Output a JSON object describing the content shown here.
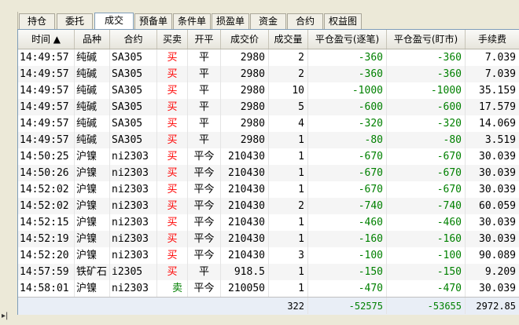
{
  "tabs": [
    {
      "label": "持仓"
    },
    {
      "label": "委托"
    },
    {
      "label": "成交"
    },
    {
      "label": "预备单"
    },
    {
      "label": "条件单"
    },
    {
      "label": "损盈单"
    },
    {
      "label": "资金"
    },
    {
      "label": "合约"
    },
    {
      "label": "权益图"
    }
  ],
  "active_tab": "成交",
  "columns": {
    "time": "时间 ▲",
    "product": "品种",
    "contract": "合约",
    "side": "买卖",
    "openclose": "开平",
    "price": "成交价",
    "qty": "成交量",
    "pnl_trade": "平仓盈亏(逐笔)",
    "pnl_mark": "平仓盈亏(盯市)",
    "fee": "手续费"
  },
  "rows": [
    {
      "time": "14:49:57",
      "product": "纯碱",
      "contract": "SA305",
      "side": "买",
      "openclose": "平",
      "price": "2980",
      "qty": "2",
      "pnl_trade": "-360",
      "pnl_mark": "-360",
      "fee": "7.039"
    },
    {
      "time": "14:49:57",
      "product": "纯碱",
      "contract": "SA305",
      "side": "买",
      "openclose": "平",
      "price": "2980",
      "qty": "2",
      "pnl_trade": "-360",
      "pnl_mark": "-360",
      "fee": "7.039"
    },
    {
      "time": "14:49:57",
      "product": "纯碱",
      "contract": "SA305",
      "side": "买",
      "openclose": "平",
      "price": "2980",
      "qty": "10",
      "pnl_trade": "-1000",
      "pnl_mark": "-1000",
      "fee": "35.159"
    },
    {
      "time": "14:49:57",
      "product": "纯碱",
      "contract": "SA305",
      "side": "买",
      "openclose": "平",
      "price": "2980",
      "qty": "5",
      "pnl_trade": "-600",
      "pnl_mark": "-600",
      "fee": "17.579"
    },
    {
      "time": "14:49:57",
      "product": "纯碱",
      "contract": "SA305",
      "side": "买",
      "openclose": "平",
      "price": "2980",
      "qty": "4",
      "pnl_trade": "-320",
      "pnl_mark": "-320",
      "fee": "14.069"
    },
    {
      "time": "14:49:57",
      "product": "纯碱",
      "contract": "SA305",
      "side": "买",
      "openclose": "平",
      "price": "2980",
      "qty": "1",
      "pnl_trade": "-80",
      "pnl_mark": "-80",
      "fee": "3.519"
    },
    {
      "time": "14:50:25",
      "product": "沪镍",
      "contract": "ni2303",
      "side": "买",
      "openclose": "平今",
      "price": "210430",
      "qty": "1",
      "pnl_trade": "-670",
      "pnl_mark": "-670",
      "fee": "30.039"
    },
    {
      "time": "14:50:26",
      "product": "沪镍",
      "contract": "ni2303",
      "side": "买",
      "openclose": "平今",
      "price": "210430",
      "qty": "1",
      "pnl_trade": "-670",
      "pnl_mark": "-670",
      "fee": "30.039"
    },
    {
      "time": "14:52:02",
      "product": "沪镍",
      "contract": "ni2303",
      "side": "买",
      "openclose": "平今",
      "price": "210430",
      "qty": "1",
      "pnl_trade": "-670",
      "pnl_mark": "-670",
      "fee": "30.039"
    },
    {
      "time": "14:52:02",
      "product": "沪镍",
      "contract": "ni2303",
      "side": "买",
      "openclose": "平今",
      "price": "210430",
      "qty": "2",
      "pnl_trade": "-740",
      "pnl_mark": "-740",
      "fee": "60.059"
    },
    {
      "time": "14:52:15",
      "product": "沪镍",
      "contract": "ni2303",
      "side": "买",
      "openclose": "平今",
      "price": "210430",
      "qty": "1",
      "pnl_trade": "-460",
      "pnl_mark": "-460",
      "fee": "30.039"
    },
    {
      "time": "14:52:19",
      "product": "沪镍",
      "contract": "ni2303",
      "side": "买",
      "openclose": "平今",
      "price": "210430",
      "qty": "1",
      "pnl_trade": "-160",
      "pnl_mark": "-160",
      "fee": "30.039"
    },
    {
      "time": "14:52:20",
      "product": "沪镍",
      "contract": "ni2303",
      "side": "买",
      "openclose": "平今",
      "price": "210430",
      "qty": "3",
      "pnl_trade": "-100",
      "pnl_mark": "-100",
      "fee": "90.089"
    },
    {
      "time": "14:57:59",
      "product": "铁矿石",
      "contract": "i2305",
      "side": "买",
      "openclose": "平",
      "price": "918.5",
      "qty": "1",
      "pnl_trade": "-150",
      "pnl_mark": "-150",
      "fee": "9.209"
    },
    {
      "time": "14:58:01",
      "product": "沪镍",
      "contract": "ni2303",
      "side": "卖",
      "openclose": "平今",
      "price": "210050",
      "qty": "1",
      "pnl_trade": "-470",
      "pnl_mark": "-470",
      "fee": "30.039"
    }
  ],
  "totals": {
    "qty": "322",
    "pnl_trade": "-52575",
    "pnl_mark": "-53655",
    "fee": "2972.85"
  },
  "colors": {
    "buy": "#ff0000",
    "sell": "#008000",
    "negative": "#008000",
    "active_tab_border": "#7f9db9"
  },
  "left_icon": "play-arrow-icon"
}
